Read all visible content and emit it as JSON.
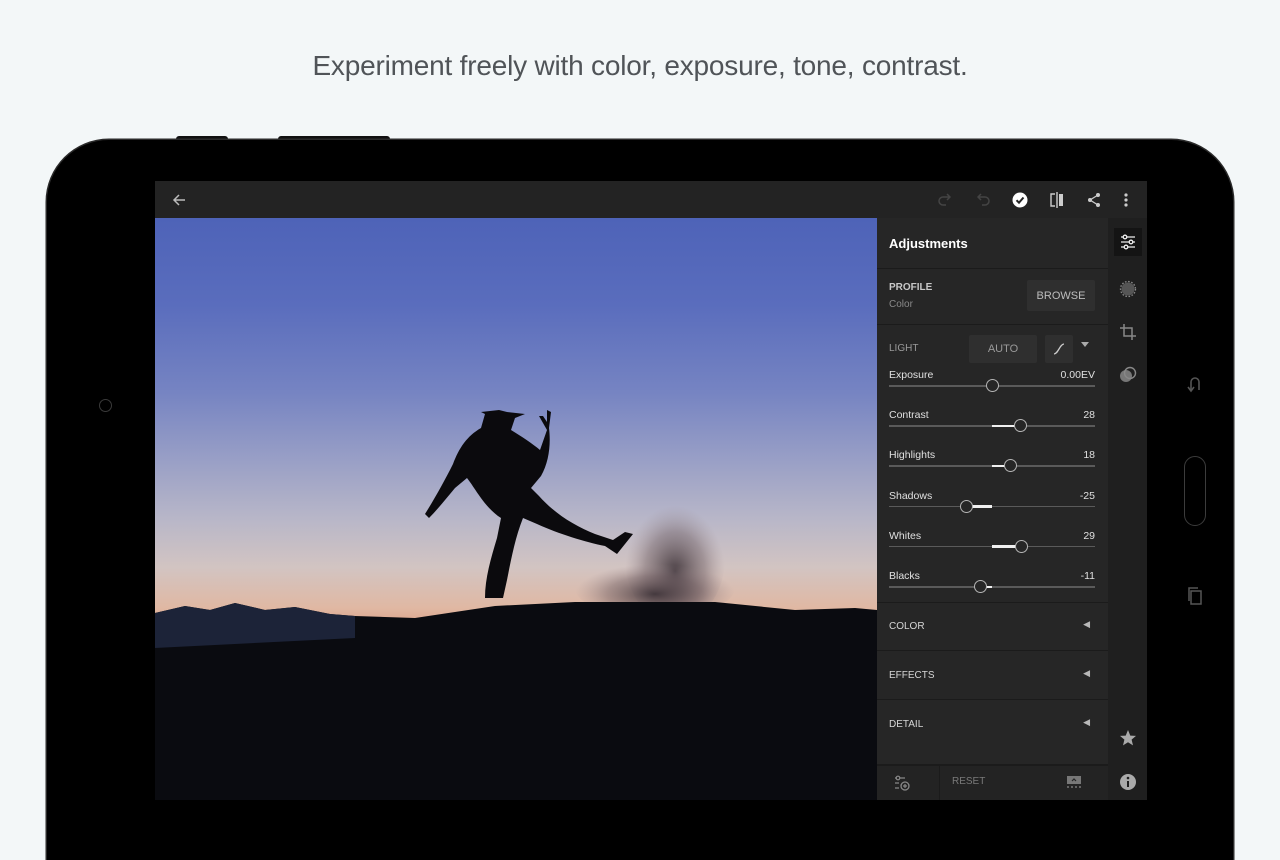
{
  "headline": "Experiment freely with color, exposure, tone, contrast.",
  "topbar": {
    "back_icon": "arrow-left-icon",
    "redo_icon": "redo-icon",
    "undo_icon": "undo-icon",
    "done_icon": "checkmark-circle-icon",
    "compare_icon": "before-after-icon",
    "share_icon": "share-icon",
    "more_icon": "more-vertical-icon"
  },
  "panel": {
    "title": "Adjustments",
    "profile": {
      "label": "PROFILE",
      "value": "Color",
      "browse": "BROWSE"
    },
    "light": {
      "label": "LIGHT",
      "auto": "AUTO",
      "sliders": [
        {
          "name": "Exposure",
          "value": "0.00EV",
          "position": 0.5
        },
        {
          "name": "Contrast",
          "value": "28",
          "position": 0.64
        },
        {
          "name": "Highlights",
          "value": "18",
          "position": 0.59
        },
        {
          "name": "Shadows",
          "value": "-25",
          "position": 0.375
        },
        {
          "name": "Whites",
          "value": "29",
          "position": 0.645
        },
        {
          "name": "Blacks",
          "value": "-11",
          "position": 0.445
        }
      ]
    },
    "sections": [
      {
        "label": "COLOR"
      },
      {
        "label": "EFFECTS"
      },
      {
        "label": "DETAIL"
      }
    ],
    "bottom": {
      "reset": "RESET"
    }
  },
  "rail": {
    "items": [
      "adjustments-icon",
      "selective-icon",
      "crop-icon",
      "presets-icon"
    ],
    "bottom": [
      "star-icon",
      "info-icon"
    ]
  }
}
